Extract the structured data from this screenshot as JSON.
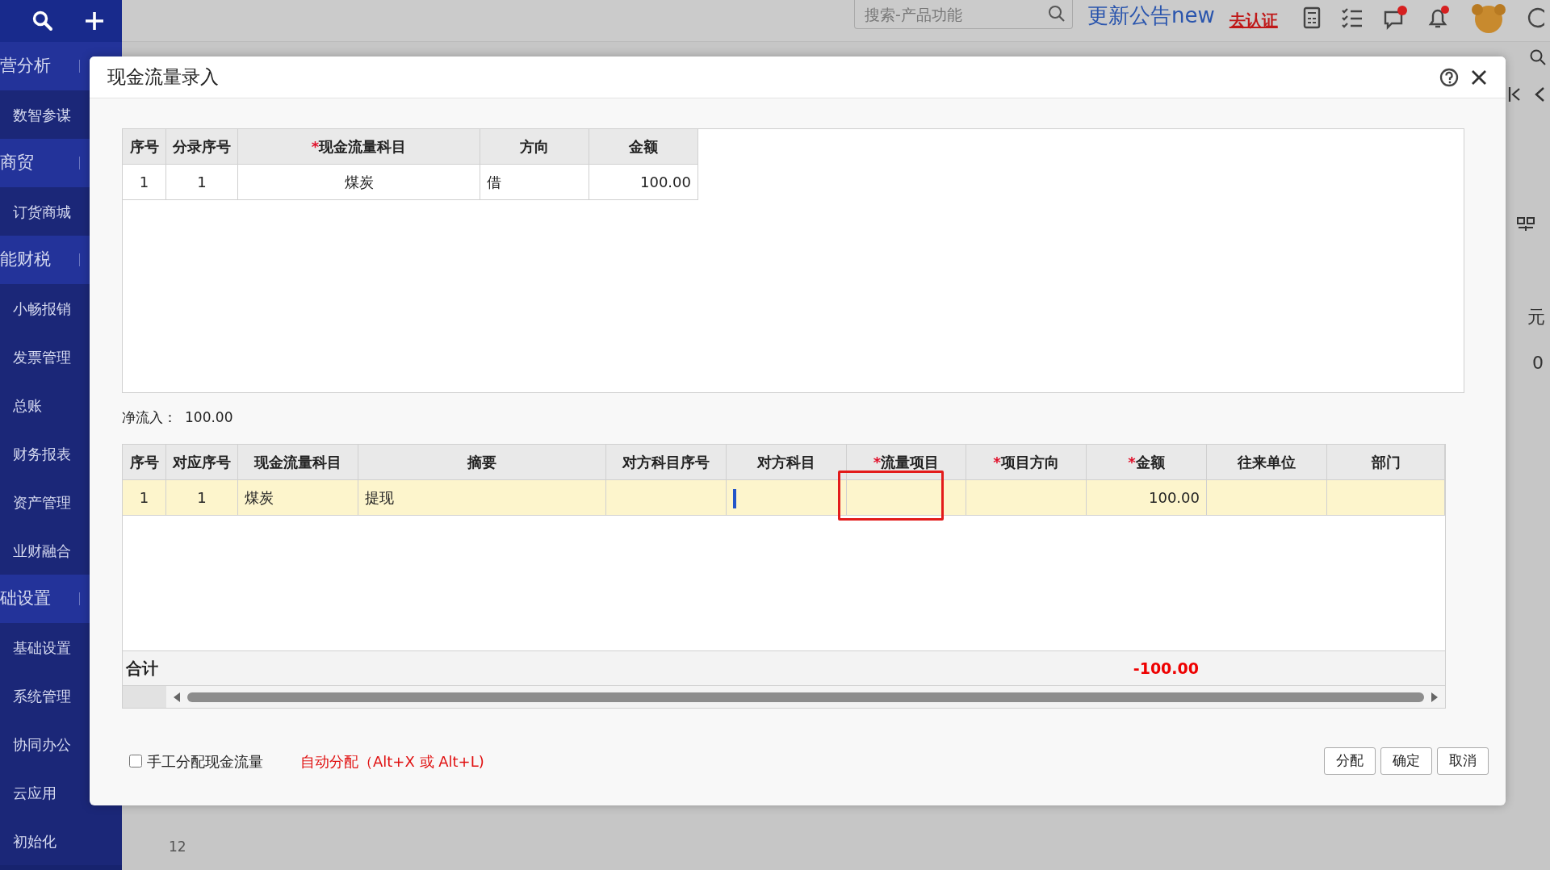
{
  "topbar": {
    "search": {
      "placeholder": "搜索-产品功能"
    },
    "announcement": "更新公告new",
    "certify_link": "去认证"
  },
  "sidebar": {
    "items": [
      {
        "label": "营分析",
        "kind": "group"
      },
      {
        "label": "数智参谋",
        "kind": "item"
      },
      {
        "label": "商贸",
        "kind": "group"
      },
      {
        "label": "订货商城",
        "kind": "item"
      },
      {
        "label": "能财税",
        "kind": "group"
      },
      {
        "label": "小畅报销",
        "kind": "item"
      },
      {
        "label": "发票管理",
        "kind": "item"
      },
      {
        "label": "总账",
        "kind": "item"
      },
      {
        "label": "财务报表",
        "kind": "item"
      },
      {
        "label": "资产管理",
        "kind": "item"
      },
      {
        "label": "业财融合",
        "kind": "item"
      },
      {
        "label": "础设置",
        "kind": "group"
      },
      {
        "label": "基础设置",
        "kind": "item"
      },
      {
        "label": "系统管理",
        "kind": "item"
      },
      {
        "label": "协同办公",
        "kind": "item"
      },
      {
        "label": "云应用",
        "kind": "item"
      },
      {
        "label": "初始化",
        "kind": "item"
      }
    ]
  },
  "background": {
    "column_header": "元",
    "cell_value": "0",
    "row_number": "12"
  },
  "dialog": {
    "title": "现金流量录入",
    "entries_table": {
      "columns": [
        {
          "label": "序号"
        },
        {
          "label": "分录序号"
        },
        {
          "label": "现金流量科目",
          "required_mark": "*"
        },
        {
          "label": "方向"
        },
        {
          "label": "金额"
        }
      ],
      "rows": [
        [
          "1",
          "1",
          "煤炭",
          "借",
          "100.00"
        ]
      ]
    },
    "net_inflow": {
      "label": "净流入：",
      "value": "100.00"
    },
    "flow_table": {
      "columns": [
        {
          "label": "序号",
          "editing": false,
          "highlighted": false
        },
        {
          "label": "对应序号",
          "editing": false,
          "highlighted": false
        },
        {
          "label": "现金流量科目",
          "editing": false,
          "highlighted": false
        },
        {
          "label": "摘要",
          "editing": false,
          "highlighted": false
        },
        {
          "label": "对方科目序号",
          "editing": false,
          "highlighted": false
        },
        {
          "label": "对方科目",
          "editing": true,
          "highlighted": false
        },
        {
          "label": "流量项目",
          "required_mark": "*",
          "editing": false,
          "highlighted": true
        },
        {
          "label": "项目方向",
          "required_mark": "*",
          "editing": false,
          "highlighted": false
        },
        {
          "label": "金额",
          "required_mark": "*",
          "editing": false,
          "highlighted": false
        },
        {
          "label": "往来单位",
          "editing": false,
          "highlighted": false
        },
        {
          "label": "部门",
          "editing": false,
          "highlighted": false
        }
      ],
      "rows": [
        {
          "selected": true,
          "cells": [
            "1",
            "1",
            "煤炭",
            "提现",
            null,
            null,
            null,
            null,
            "100.00",
            null,
            null
          ]
        }
      ],
      "total": {
        "label": "合计",
        "amount": "-100.00"
      }
    },
    "manual_allocate": {
      "label": "手工分配现金流量",
      "checked": false
    },
    "auto_allocate_hint": "自动分配（Alt+X 或 Alt+L)",
    "buttons": [
      "分配",
      "确定",
      "取消"
    ]
  }
}
